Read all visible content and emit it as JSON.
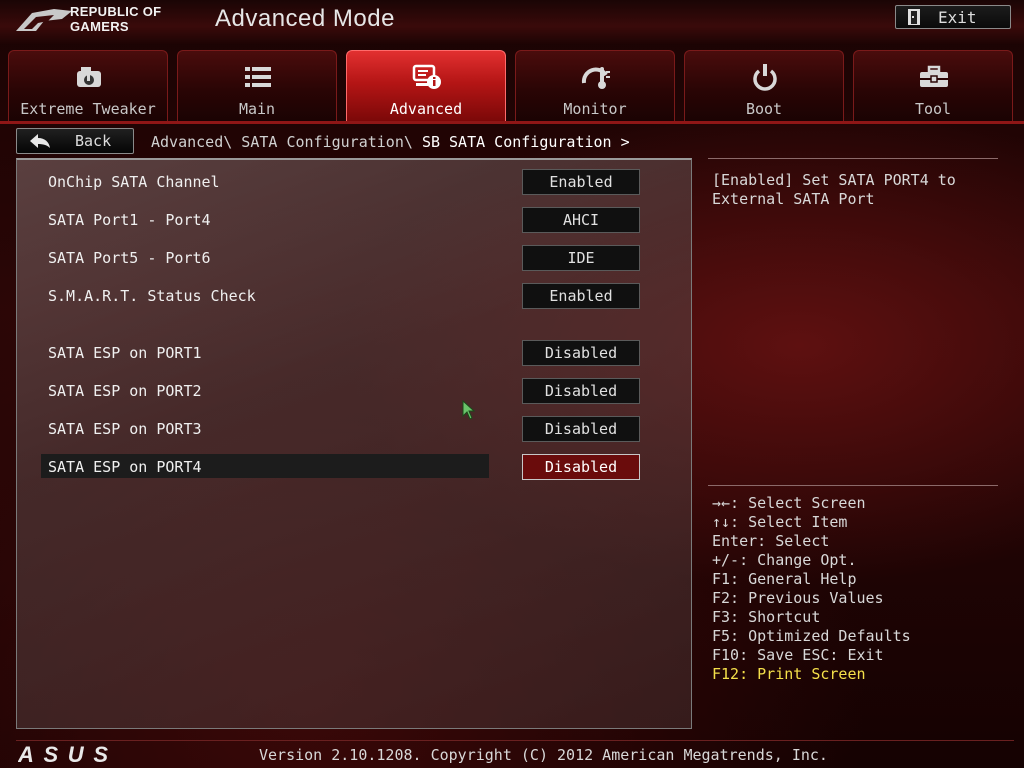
{
  "header": {
    "brand_line1": "REPUBLIC OF",
    "brand_line2": "GAMERS",
    "mode_title": "Advanced Mode",
    "exit_label": "Exit"
  },
  "tabs": [
    {
      "label": "Extreme Tweaker",
      "icon": "gauge-icon",
      "active": false
    },
    {
      "label": "Main",
      "icon": "list-icon",
      "active": false
    },
    {
      "label": "Advanced",
      "icon": "advanced-info-icon",
      "active": true
    },
    {
      "label": "Monitor",
      "icon": "monitor-gauge-icon",
      "active": false
    },
    {
      "label": "Boot",
      "icon": "power-icon",
      "active": false
    },
    {
      "label": "Tool",
      "icon": "toolbox-icon",
      "active": false
    }
  ],
  "nav": {
    "back_label": "Back",
    "breadcrumb_path": "Advanced\\ SATA Configuration\\",
    "breadcrumb_current": "SB SATA Configuration >"
  },
  "settings": [
    {
      "label": "OnChip SATA Channel",
      "value": "Enabled"
    },
    {
      "label": "SATA Port1 - Port4",
      "value": "AHCI"
    },
    {
      "label": "SATA Port5 - Port6",
      "value": "IDE"
    },
    {
      "label": "S.M.A.R.T. Status Check",
      "value": "Enabled"
    },
    {
      "label": "SATA ESP on PORT1",
      "value": "Disabled"
    },
    {
      "label": "SATA ESP on PORT2",
      "value": "Disabled"
    },
    {
      "label": "SATA ESP on PORT3",
      "value": "Disabled"
    },
    {
      "label": "SATA ESP on PORT4",
      "value": "Disabled",
      "selected": true
    }
  ],
  "help": {
    "text": "[Enabled] Set SATA PORT4 to External SATA Port"
  },
  "keys": [
    "→←: Select Screen",
    "↑↓: Select Item",
    "Enter: Select",
    "+/-: Change Opt.",
    "F1: General Help",
    "F2: Previous Values",
    "F3: Shortcut",
    "F5: Optimized Defaults",
    "F10: Save  ESC: Exit",
    "F12: Print Screen"
  ],
  "footer": {
    "version": "Version 2.10.1208. Copyright (C) 2012 American Megatrends, Inc.",
    "brand": "ASUS"
  },
  "colors": {
    "active_tab": "#c41a1a",
    "selected_value_bg": "#6a0c0c",
    "highlight_key": "#f5e04a"
  }
}
